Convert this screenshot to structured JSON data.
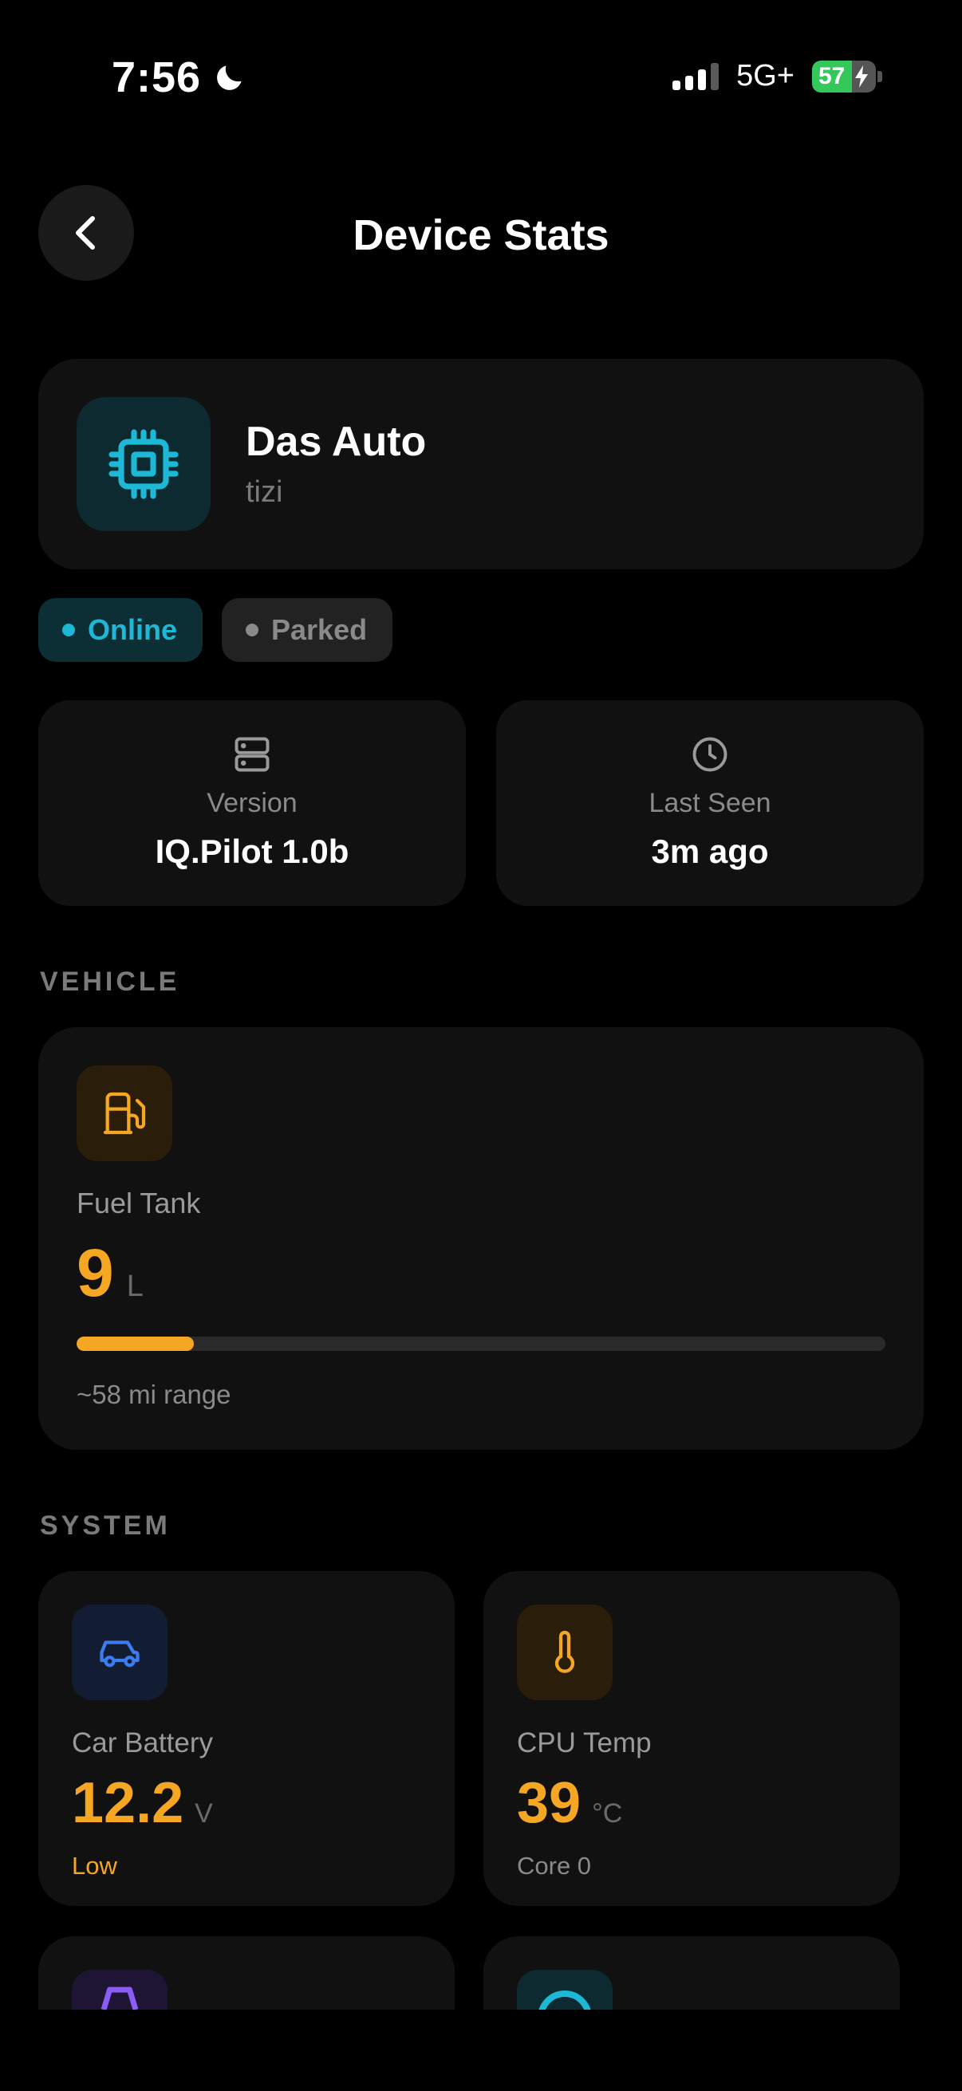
{
  "status_bar": {
    "time": "7:56",
    "network": "5G+",
    "battery": "57"
  },
  "header": {
    "title": "Device Stats",
    "back_icon": "chevron-left-icon"
  },
  "device": {
    "name": "Das Auto",
    "model": "tizi",
    "icon": "cpu-chip-icon",
    "accent": "#1cb8d6"
  },
  "badges": [
    {
      "label": "Online",
      "color": "#1cb8d6"
    },
    {
      "label": "Parked",
      "color": "#8a8a8a"
    }
  ],
  "info_cards": [
    {
      "icon": "server-icon",
      "label": "Version",
      "value": "IQ.Pilot 1.0b"
    },
    {
      "icon": "clock-icon",
      "label": "Last Seen",
      "value": "3m ago"
    }
  ],
  "sections": {
    "vehicle": "VEHICLE",
    "system": "SYSTEM"
  },
  "fuel": {
    "icon": "fuel-pump-icon",
    "title": "Fuel Tank",
    "value": "9",
    "unit": "L",
    "level_fraction": 0.145,
    "range": "~58 mi range",
    "accent": "#f5a623"
  },
  "system_cards": [
    {
      "icon": "car-icon",
      "icon_color": "#3b7cf0",
      "title": "Car Battery",
      "value": "12.2",
      "unit": "V",
      "sub": "Low",
      "sub_color": "#f5a623"
    },
    {
      "icon": "thermometer-icon",
      "icon_color": "#f5a623",
      "title": "CPU Temp",
      "value": "39",
      "unit": "°C",
      "sub": "Core 0",
      "sub_color": "#8a8a8a"
    }
  ]
}
